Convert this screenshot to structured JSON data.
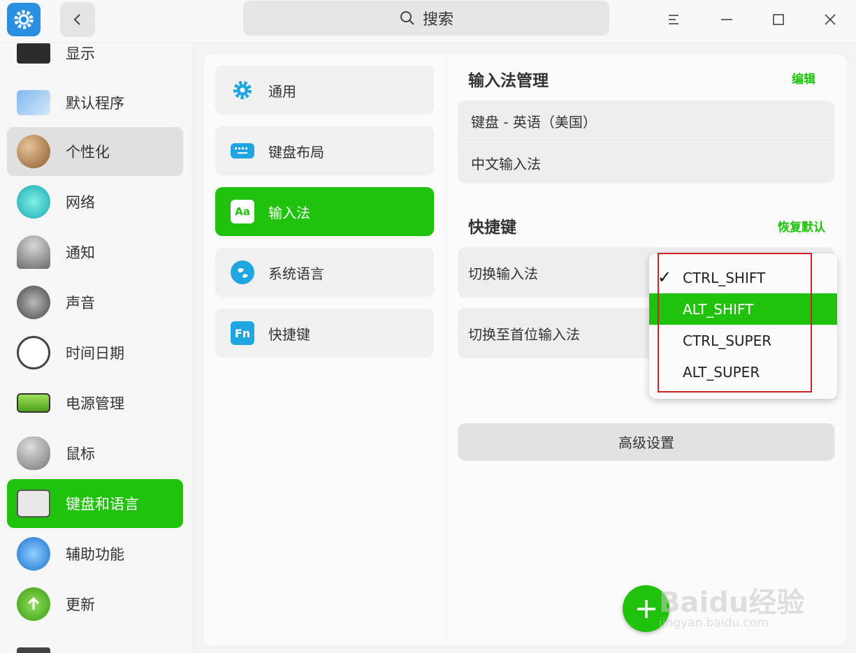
{
  "header": {
    "search_label": "搜索"
  },
  "sidebar": {
    "items": [
      {
        "label": "显示",
        "icon": "monitor-icon"
      },
      {
        "label": "默认程序",
        "icon": "default-apps-icon"
      },
      {
        "label": "个性化",
        "icon": "palette-icon"
      },
      {
        "label": "网络",
        "icon": "network-icon"
      },
      {
        "label": "通知",
        "icon": "bell-icon"
      },
      {
        "label": "声音",
        "icon": "speaker-icon"
      },
      {
        "label": "时间日期",
        "icon": "clock-icon"
      },
      {
        "label": "电源管理",
        "icon": "battery-icon"
      },
      {
        "label": "鼠标",
        "icon": "mouse-icon"
      },
      {
        "label": "键盘和语言",
        "icon": "keyboard-icon"
      },
      {
        "label": "辅助功能",
        "icon": "accessibility-icon"
      },
      {
        "label": "更新",
        "icon": "update-icon"
      }
    ]
  },
  "middle": {
    "items": [
      {
        "label": "通用",
        "icon": "gear-icon"
      },
      {
        "label": "键盘布局",
        "icon": "keyboard-layout-icon"
      },
      {
        "label": "输入法",
        "icon": "input-method-icon"
      },
      {
        "label": "系统语言",
        "icon": "globe-icon"
      },
      {
        "label": "快捷键",
        "icon": "fn-key-icon"
      }
    ],
    "input_icon_text": "Aa",
    "fn_icon_text": "Fn"
  },
  "main": {
    "im_section_title": "输入法管理",
    "edit_label": "编辑",
    "im_list": [
      "键盘 - 英语（美国）",
      "中文输入法"
    ],
    "shortcut_section_title": "快捷键",
    "restore_label": "恢复默认",
    "switch_im_label": "切换输入法",
    "switch_first_label": "切换至首位输入法",
    "advanced_label": "高级设置"
  },
  "dropdown": {
    "options": [
      "CTRL_SHIFT",
      "ALT_SHIFT",
      "CTRL_SUPER",
      "ALT_SUPER"
    ],
    "checked": "CTRL_SHIFT",
    "highlighted": "ALT_SHIFT"
  },
  "watermark": {
    "brand": "Baidu经验",
    "url": "jingyan.baidu.com"
  },
  "colors": {
    "accent": "#20c20e",
    "highlight_box": "#d0202a"
  }
}
